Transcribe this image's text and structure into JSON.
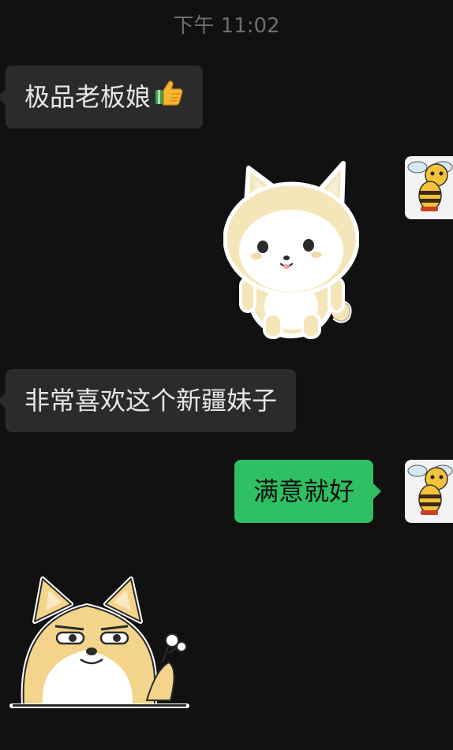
{
  "chat": {
    "timestamp": "下午 11:02",
    "messages": [
      {
        "side": "in",
        "type": "text",
        "text": "极品老板娘",
        "emoji": "thumbs-up"
      },
      {
        "side": "out",
        "type": "sticker",
        "sticker": "cream-shiba-standing"
      },
      {
        "side": "in",
        "type": "text",
        "text": "非常喜欢这个新疆妹子"
      },
      {
        "side": "out",
        "type": "text",
        "text": "满意就好"
      },
      {
        "side": "in",
        "type": "sticker",
        "sticker": "shiba-smug-holding-flower"
      }
    ]
  },
  "colors": {
    "background": "#111111",
    "incoming_bubble": "#2b2b2b",
    "outgoing_bubble": "#2ec063",
    "timestamp_text": "#6e6e6e"
  },
  "avatar": {
    "icon": "bee-avatar-icon"
  }
}
